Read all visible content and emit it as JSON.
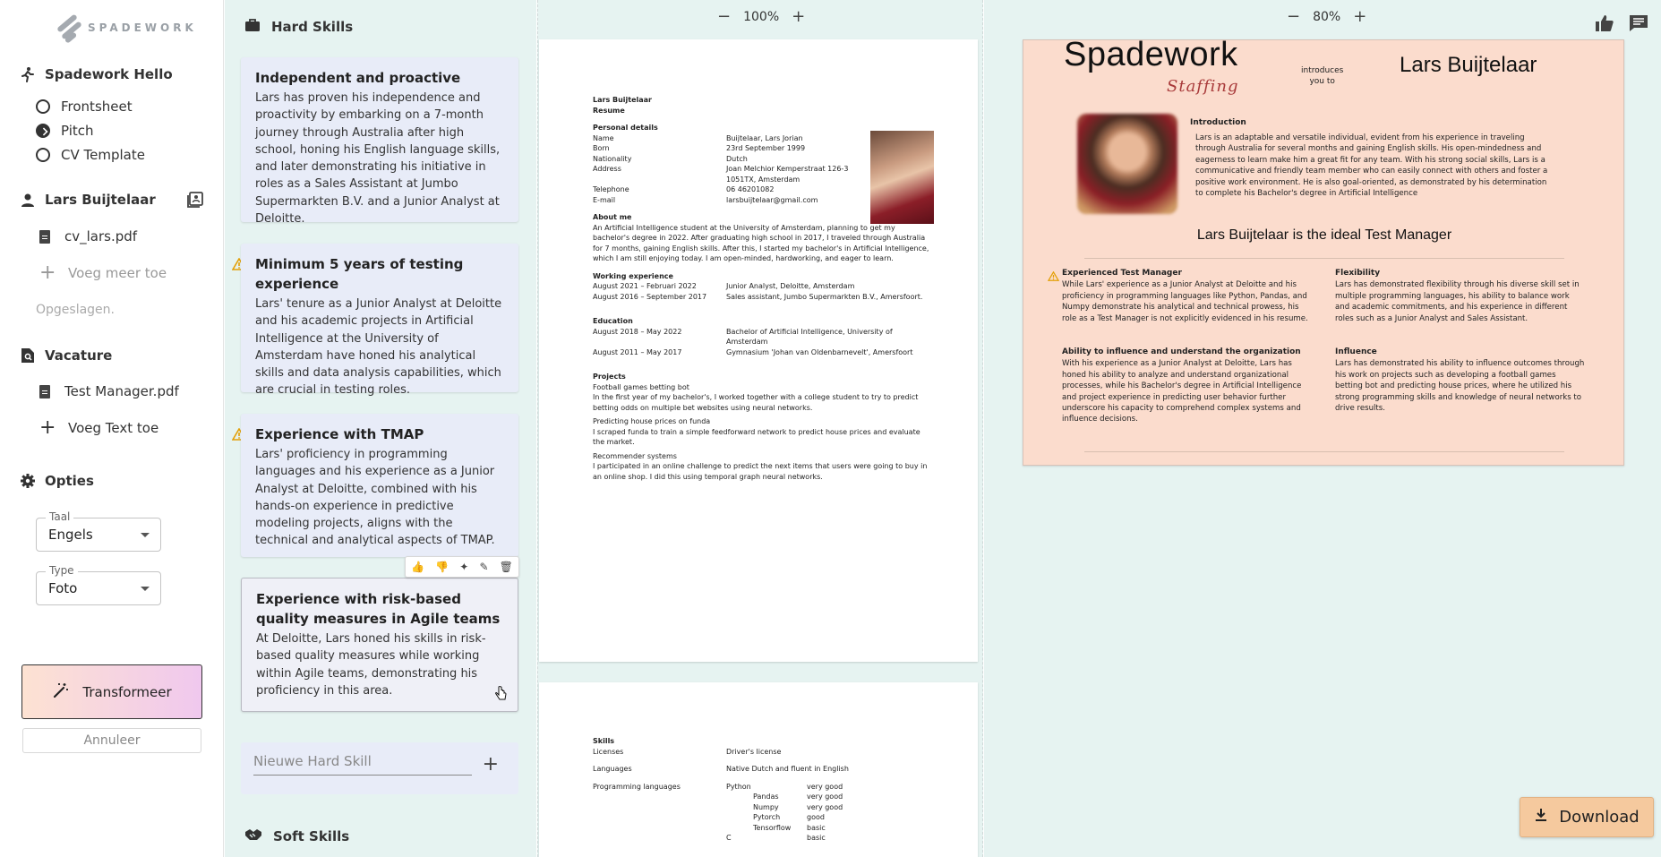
{
  "sidebar": {
    "logo_text": "SPADEWORK",
    "hello_title": "Spadework Hello",
    "radio_items": [
      {
        "label": "Frontsheet",
        "checked": false
      },
      {
        "label": "Pitch",
        "checked": true
      },
      {
        "label": "CV Template",
        "checked": false
      }
    ],
    "candidate_name": "Lars Buijtelaar",
    "cv_file": "cv_lars.pdf",
    "add_more": "Voeg meer toe",
    "saved": "Opgeslagen.",
    "vacancy_title": "Vacature",
    "vacancy_file": "Test Manager.pdf",
    "add_text": "Voeg Text toe",
    "options_title": "Opties",
    "language_label": "Taal",
    "language_value": "Engels",
    "type_label": "Type",
    "type_value": "Foto",
    "transform_label": "Transformeer",
    "cancel_label": "Annuleer"
  },
  "skills": {
    "hard_title": "Hard Skills",
    "cards": [
      {
        "title": "Independent and proactive",
        "text": "Lars has proven his independence and proactivity by embarking on a 7-month journey through Australia after high school, honing his English language skills, and later demonstrating his initiative in roles as a Sales Assistant at Jumbo Supermarkten B.V. and a Junior Analyst at Deloitte.",
        "warning": false
      },
      {
        "title": "Minimum 5 years of testing experience",
        "text": "Lars' tenure as a Junior Analyst at Deloitte and his academic projects in Artificial Intelligence at the University of Amsterdam have honed his analytical skills and data analysis capabilities, which are crucial in testing roles.",
        "warning": true
      },
      {
        "title": "Experience with TMAP",
        "text": "Lars' proficiency in programming languages and his experience as a Junior Analyst at Deloitte, combined with his hands-on experience in predictive modeling projects, aligns with the technical and analytical aspects of TMAP.",
        "warning": true
      },
      {
        "title": "Experience with risk-based quality measures in Agile teams",
        "text": "At Deloitte, Lars honed his skills in risk-based quality measures while working within Agile teams, demonstrating his proficiency in this area.",
        "warning": false
      }
    ],
    "new_placeholder": "Nieuwe Hard Skill",
    "soft_title": "Soft Skills"
  },
  "cv_preview": {
    "zoom": "100%",
    "name": "Lars Buijtelaar",
    "subtitle": "Resume",
    "personal_title": "Personal details",
    "personal": [
      {
        "k": "Name",
        "v": "Buijtelaar, Lars Jorian"
      },
      {
        "k": "Born",
        "v": "23rd September 1999"
      },
      {
        "k": "Nationality",
        "v": "Dutch"
      },
      {
        "k": "Address",
        "v": "Joan Melchior Kemperstraat 126-3"
      },
      {
        "k": "",
        "v": "1051TX, Amsterdam"
      },
      {
        "k": "Telephone",
        "v": "06 46201082"
      },
      {
        "k": "E-mail",
        "v": "larsbuijtelaar@gmail.com"
      }
    ],
    "about_title": "About me",
    "about_text": "An Artificial Intelligence student at the University of Amsterdam, planning to get my bachelor's degree in 2022. After graduating high school in 2017, I traveled through Australia for 7 months, gaining English skills. After this, I started my bachelor's in Artificial Intelligence, which I am still enjoying today. I am open-minded, hardworking, and eager to learn.",
    "work_title": "Working experience",
    "work": [
      {
        "k": "August 2021 – Februari 2022",
        "v": "Junior Analyst, Deloitte, Amsterdam"
      },
      {
        "k": "August 2016 – September 2017",
        "v": "Sales assistant, Jumbo Supermarkten B.V., Amersfoort."
      }
    ],
    "edu_title": "Education",
    "edu": [
      {
        "k": "August 2018 – May 2022",
        "v": "Bachelor of Artificial Intelligence, University of Amsterdam"
      },
      {
        "k": "August 2011 – May 2017",
        "v": "Gymnasium 'Johan van Oldenbarnevelt', Amersfoort"
      }
    ],
    "projects_title": "Projects",
    "projects": [
      {
        "title": "Football games betting bot",
        "text": "In the first year of my bachelor's, I worked together with a college student to try to predict betting odds on multiple bet websites using neural networks."
      },
      {
        "title": "Predicting house prices on funda",
        "text": "I scraped funda to train a simple feedforward network to predict house prices and evaluate the market."
      },
      {
        "title": "Recommender systems",
        "text": "I participated in an online challenge to predict the next items that users were going to buy in an online shop. I did this using temporal graph neural networks."
      }
    ],
    "skills_title": "Skills",
    "licenses_k": "Licenses",
    "licenses_v": "Driver's license",
    "languages_k": "Languages",
    "languages_v": "Native Dutch and fluent in English",
    "prog_k": "Programming languages",
    "prog": [
      {
        "name": "Python",
        "level": "very good"
      },
      {
        "name": "Pandas",
        "level": "very good"
      },
      {
        "name": "Numpy",
        "level": "very good"
      },
      {
        "name": "Pytorch",
        "level": "good"
      },
      {
        "name": "Tensorflow",
        "level": "basic"
      },
      {
        "name": "C",
        "level": "basic"
      }
    ]
  },
  "pitch_preview": {
    "zoom": "80%",
    "brand": "Spadework",
    "brand_sub": "Staffing",
    "introduces": "introduces",
    "you_to": "you to",
    "name": "Lars Buijtelaar",
    "intro_title": "Introduction",
    "intro_text": "Lars is an adaptable and versatile individual, evident from his experience in traveling through Australia for several months and gaining English skills. His open-mindedness and eagerness to learn make him a great fit for any team. With his strong social skills, Lars is a communicative and friendly team member who can easily connect with others and foster a positive work environment. He is also goal-oriented, as demonstrated by his determination to complete his Bachelor's degree in Artificial Intelligence",
    "ideal": "Lars Buijtelaar is the ideal Test Manager",
    "blocks": [
      {
        "title": "Experienced Test Manager",
        "text": "While Lars' experience as a Junior Analyst at Deloitte and his proficiency in programming languages like Python, Pandas, and Numpy demonstrate his analytical and technical prowess, his role as a Test Manager is not explicitly evidenced in his resume."
      },
      {
        "title": "Flexibility",
        "text": "Lars has demonstrated flexibility through his diverse skill set in multiple programming languages, his ability to balance work and academic commitments, and his experience in different roles such as a Junior Analyst and Sales Assistant."
      },
      {
        "title": "Ability to influence and understand the organization",
        "text": "With his experience as a Junior Analyst at Deloitte, Lars has honed his ability to analyze and understand organizational processes, while his Bachelor's degree in Artificial Intelligence and project experience in predicting user behavior further underscore his capacity to comprehend complex systems and influence decisions."
      },
      {
        "title": "Influence",
        "text": "Lars has demonstrated his ability to influence outcomes through his work on projects such as developing a football games betting bot and predicting house prices, where he utilized his strong programming skills and knowledge of neural networks to drive results."
      }
    ],
    "download_label": "Download"
  },
  "colors": {
    "panel_bg": "#e6f3f1",
    "card_bg": "#e8ecf8",
    "pitch_bg": "#fbdccd",
    "warning": "#e3a008",
    "download_bg": "#f5c99e"
  }
}
